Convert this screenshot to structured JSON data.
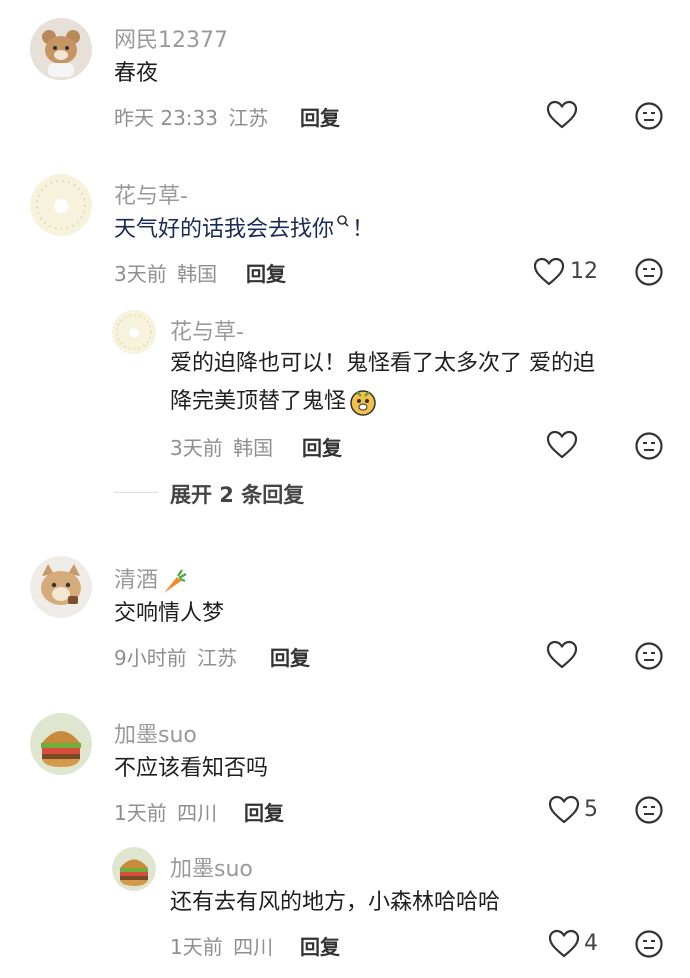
{
  "comments": [
    {
      "user": "网民12377",
      "text": "春夜",
      "time": "昨天 23:33",
      "loc": "江苏",
      "reply": "回复",
      "likes": ""
    },
    {
      "user": "花与草-",
      "text": "天气好的话我会去找你",
      "time": "3天前",
      "loc": "韩国",
      "reply": "回复",
      "likes": "12",
      "sub": {
        "user": "花与草-",
        "text1": "爱的迫降也可以！鬼怪看了太多次了 爱的迫",
        "text2": "降完美顶替了鬼怪",
        "time": "3天前",
        "loc": "韩国",
        "reply": "回复",
        "likes": ""
      },
      "expand": "展开 2 条回复"
    },
    {
      "user": "清酒",
      "text": "交响情人梦",
      "time": "9小时前",
      "loc": "江苏",
      "reply": "回复",
      "likes": ""
    },
    {
      "user": "加墨suo",
      "text": "不应该看知否吗",
      "time": "1天前",
      "loc": "四川",
      "reply": "回复",
      "likes": "5",
      "sub": {
        "user": "加墨suo",
        "text1": "还有去有风的地方，小森林哈哈哈",
        "time": "1天前",
        "loc": "四川",
        "reply": "回复",
        "likes": "4"
      }
    }
  ]
}
